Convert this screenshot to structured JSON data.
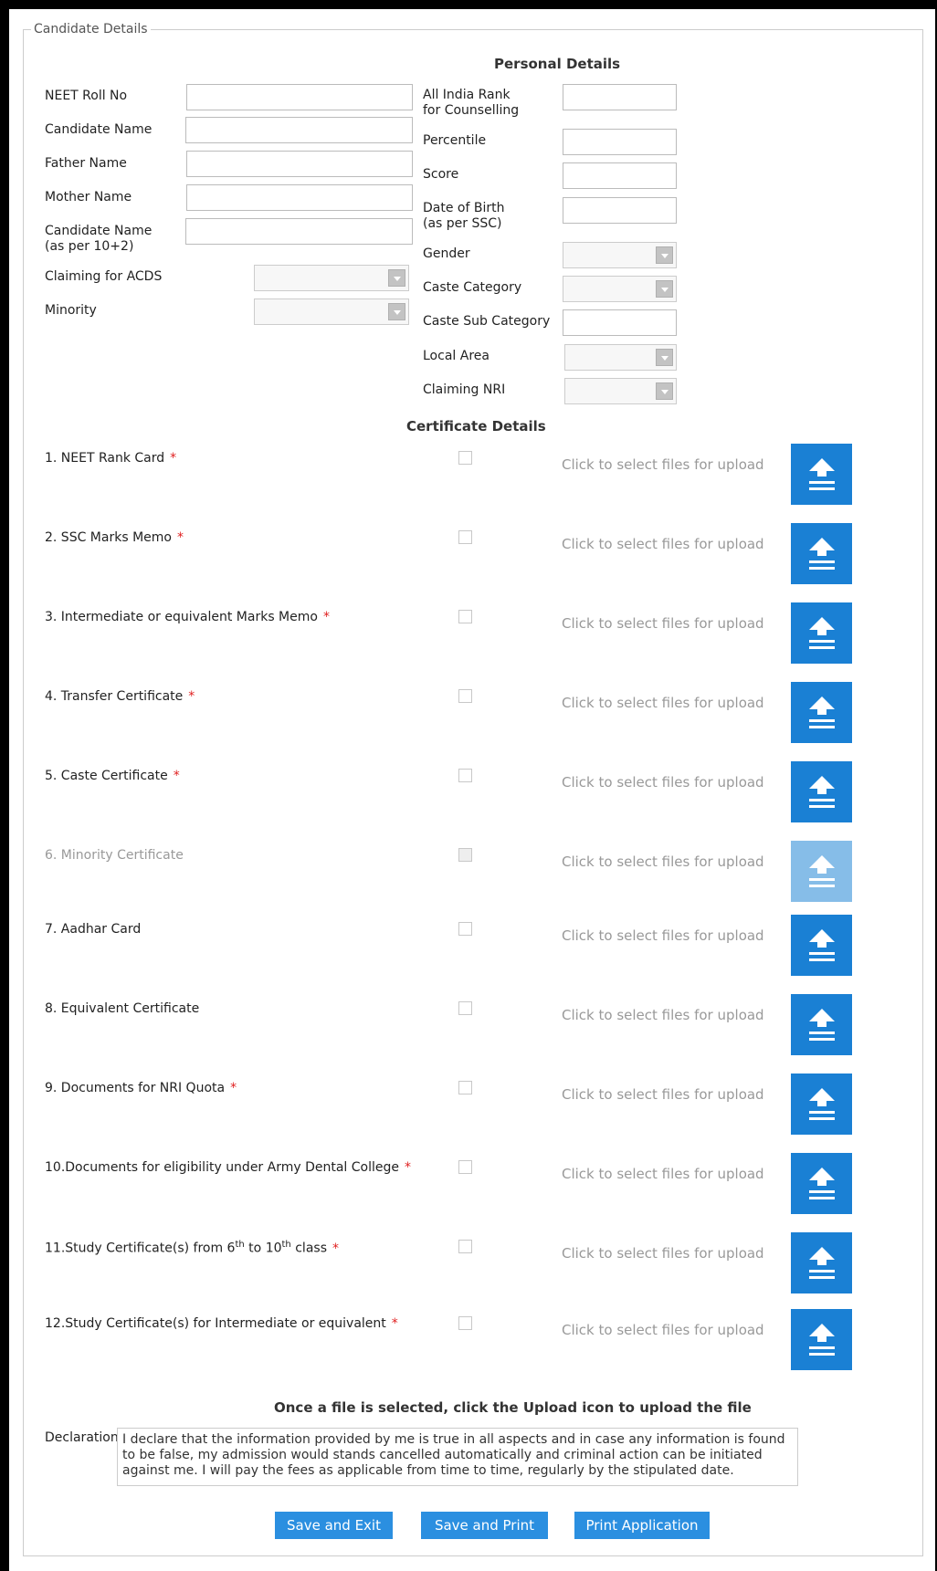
{
  "fieldset_legend": "Candidate Details",
  "personal_heading": "Personal Details",
  "left_fields": [
    {
      "label": "NEET Roll No",
      "value": ""
    },
    {
      "label": "Candidate Name",
      "value": ""
    },
    {
      "label": "Father Name",
      "value": ""
    },
    {
      "label": "Mother Name",
      "value": ""
    },
    {
      "label": "Candidate Name\n(as per 10+2)",
      "value": ""
    },
    {
      "label": "Claiming for ACDS",
      "value": ""
    },
    {
      "label": "Minority",
      "value": ""
    }
  ],
  "right_fields": [
    {
      "label": "All India Rank\nfor Counselling",
      "value": ""
    },
    {
      "label": "Percentile",
      "value": ""
    },
    {
      "label": "Score",
      "value": ""
    },
    {
      "label": "Date of Birth\n(as per SSC)",
      "value": ""
    },
    {
      "label": "Gender",
      "value": ""
    },
    {
      "label": "Caste Category",
      "value": ""
    },
    {
      "label": "Caste Sub Category",
      "value": ""
    },
    {
      "label": "Local Area",
      "value": ""
    },
    {
      "label": "Claiming NRI",
      "value": ""
    }
  ],
  "certificate_heading": "Certificate Details",
  "upload_hint": "Click to select files for upload",
  "certificates": [
    {
      "label": "1. NEET Rank Card",
      "required": "*"
    },
    {
      "label": "2. SSC Marks Memo",
      "required": "*"
    },
    {
      "label": "3. Intermediate or equivalent Marks Memo",
      "required": "*"
    },
    {
      "label": "4. Transfer Certificate",
      "required": "*"
    },
    {
      "label": "5. Caste Certificate",
      "required": "*"
    },
    {
      "label": "6. Minority Certificate",
      "required": ""
    },
    {
      "label": "7. Aadhar Card",
      "required": ""
    },
    {
      "label": "8. Equivalent Certificate",
      "required": ""
    },
    {
      "label": "9. Documents for NRI Quota",
      "required": "*"
    },
    {
      "label": "10.Documents for eligibility under Army Dental College",
      "required": "*"
    },
    {
      "label_pre": "11.Study Certificate(s) from 6",
      "sup1": "th",
      "label_mid": " to 10",
      "sup2": "th",
      "label_post": " class",
      "required": "*"
    },
    {
      "label": "12.Study Certificate(s) for Intermediate or equivalent",
      "required": "*"
    }
  ],
  "upload_note": "Once a file is selected, click the Upload icon to upload the file",
  "declaration_label": "Declaration",
  "declaration_text": "I declare that the information provided by me is true in all aspects and in case any information is found to be false, my admission would stands cancelled automatically and criminal action can be initiated against me. I will pay the fees as applicable from time to time, regularly by the stipulated date.",
  "buttons": {
    "save_exit": "Save and Exit",
    "save_print": "Save and Print",
    "print_application": "Print Application"
  },
  "colors": {
    "accent": "#1a80d4",
    "button": "#2b8fe0",
    "required": "#e02020"
  }
}
